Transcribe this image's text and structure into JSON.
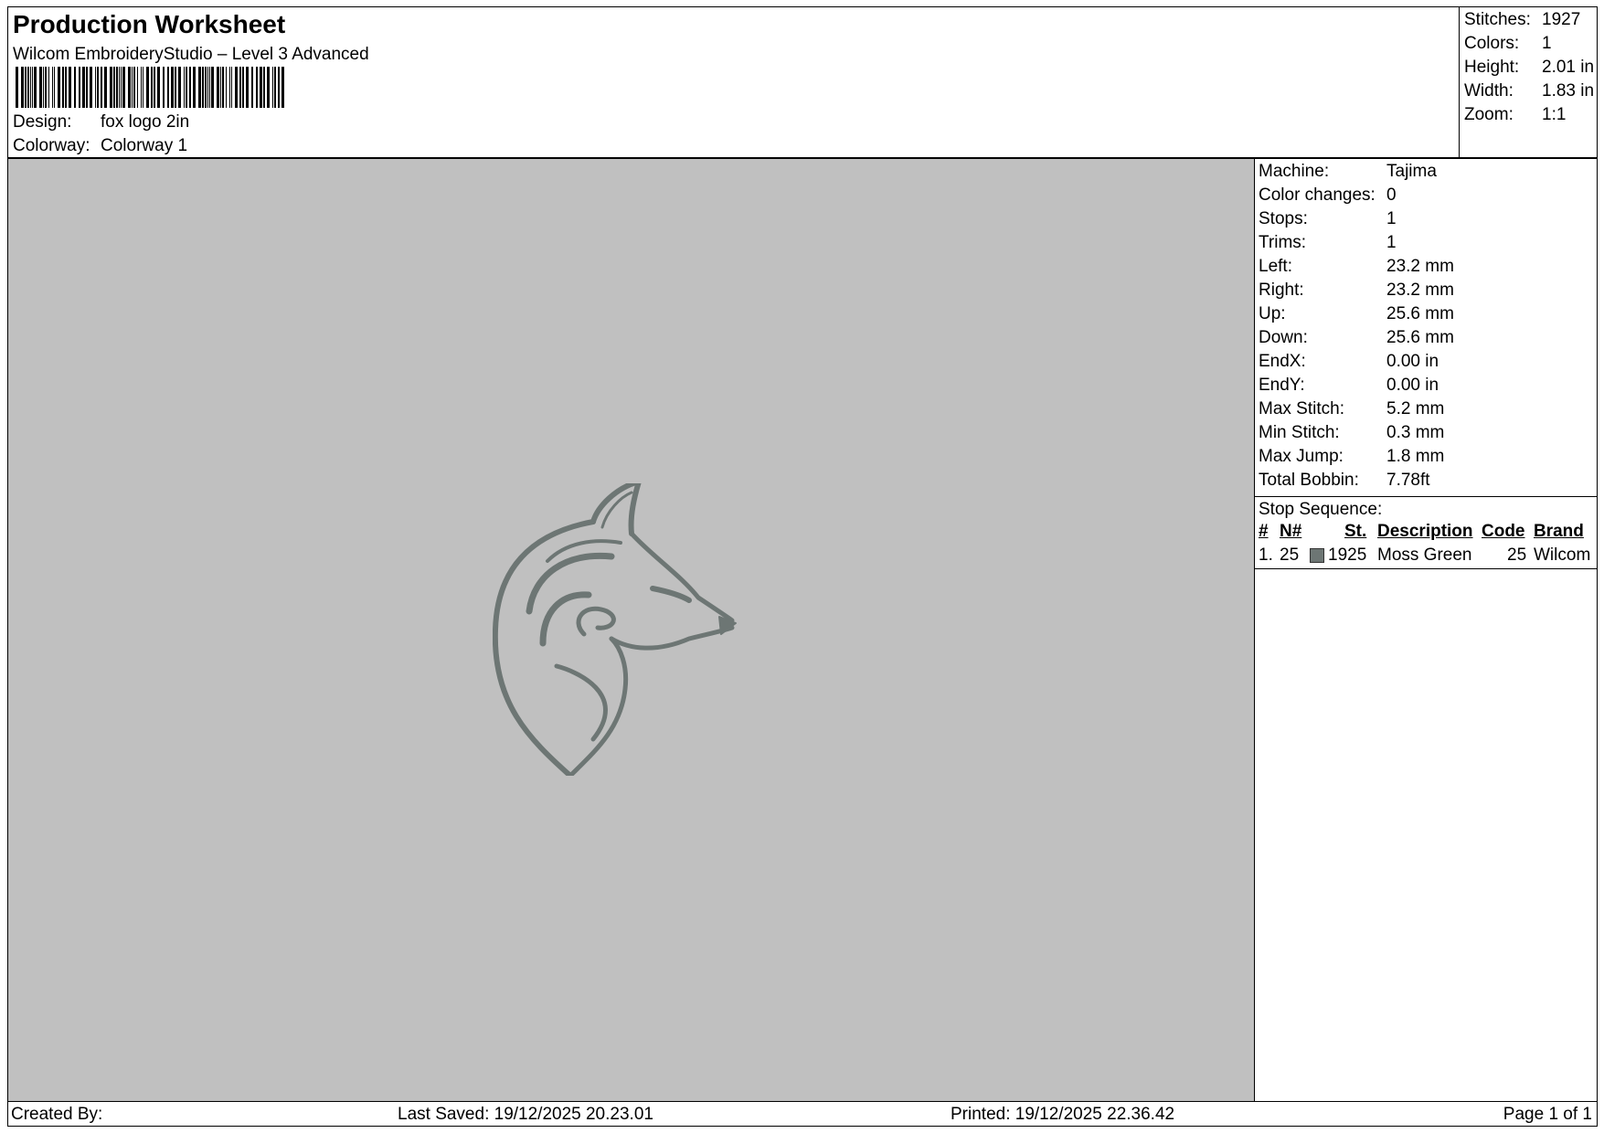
{
  "header": {
    "title": "Production Worksheet",
    "subtitle": "Wilcom EmbroideryStudio – Level 3 Advanced",
    "design_label": "Design:",
    "design_value": "fox logo 2in",
    "colorway_label": "Colorway:",
    "colorway_value": "Colorway 1"
  },
  "summary": {
    "stitches_label": "Stitches:",
    "stitches_value": "1927",
    "colors_label": "Colors:",
    "colors_value": "1",
    "height_label": "Height:",
    "height_value": "2.01 in",
    "width_label": "Width:",
    "width_value": "1.83 in",
    "zoom_label": "Zoom:",
    "zoom_value": "1:1"
  },
  "machine": {
    "rows": [
      {
        "label": "Machine:",
        "value": "Tajima"
      },
      {
        "label": "Color changes:",
        "value": "0"
      },
      {
        "label": "Stops:",
        "value": "1"
      },
      {
        "label": "Trims:",
        "value": "1"
      },
      {
        "label": "Left:",
        "value": "23.2 mm"
      },
      {
        "label": "Right:",
        "value": "23.2 mm"
      },
      {
        "label": "Up:",
        "value": "25.6 mm"
      },
      {
        "label": "Down:",
        "value": "25.6 mm"
      },
      {
        "label": "EndX:",
        "value": "0.00 in"
      },
      {
        "label": "EndY:",
        "value": "0.00 in"
      },
      {
        "label": "Max Stitch:",
        "value": "5.2 mm"
      },
      {
        "label": "Min Stitch:",
        "value": "0.3 mm"
      },
      {
        "label": "Max Jump:",
        "value": "1.8 mm"
      },
      {
        "label": "Total Bobbin:",
        "value": "7.78ft"
      }
    ]
  },
  "stop_sequence": {
    "title": "Stop Sequence:",
    "headers": {
      "num": "#",
      "needle": "N#",
      "stitches": "St.",
      "description": "Description",
      "code": "Code",
      "brand": "Brand"
    },
    "rows": [
      {
        "num": "1.",
        "needle": "25",
        "stitches": "1925",
        "description": "Moss Green",
        "code": "25",
        "brand": "Wilcom",
        "color": "#6d7674"
      }
    ]
  },
  "footer": {
    "created_by": "Created By:",
    "last_saved": "Last Saved: 19/12/2025 20.23.01",
    "printed": "Printed: 19/12/2025 22.36.42",
    "page": "Page 1 of 1"
  },
  "canvas": {
    "background": "#c0c0c0",
    "thread_color": "#6d7674",
    "design_icon": "fox-head-icon"
  }
}
